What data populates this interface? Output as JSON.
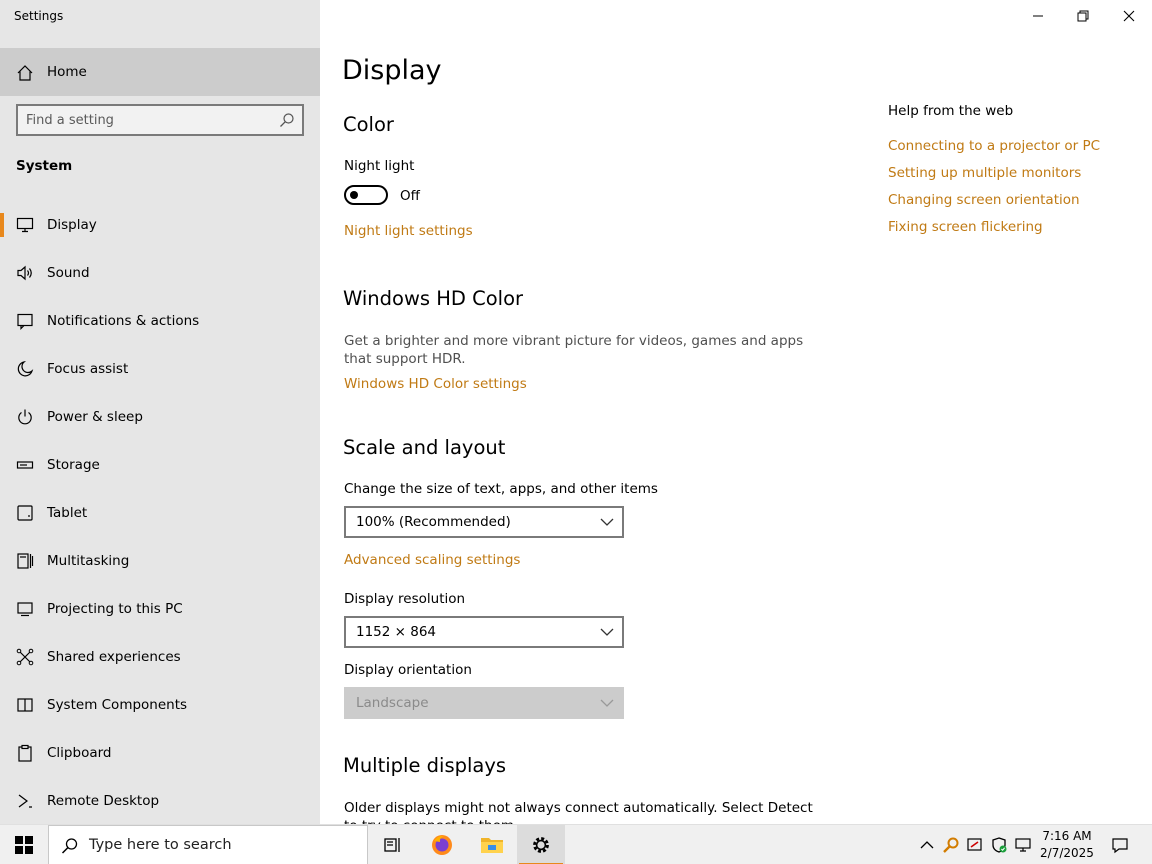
{
  "window": {
    "title": "Settings"
  },
  "sidebar": {
    "home_label": "Home",
    "search_placeholder": "Find a setting",
    "section_label": "System",
    "items": [
      {
        "label": "Display",
        "icon": "monitor-icon",
        "active": true
      },
      {
        "label": "Sound",
        "icon": "speaker-icon"
      },
      {
        "label": "Notifications & actions",
        "icon": "notification-icon"
      },
      {
        "label": "Focus assist",
        "icon": "moon-icon"
      },
      {
        "label": "Power & sleep",
        "icon": "power-icon"
      },
      {
        "label": "Storage",
        "icon": "storage-icon"
      },
      {
        "label": "Tablet",
        "icon": "tablet-icon"
      },
      {
        "label": "Multitasking",
        "icon": "multitasking-icon"
      },
      {
        "label": "Projecting to this PC",
        "icon": "projecting-icon"
      },
      {
        "label": "Shared experiences",
        "icon": "shared-icon"
      },
      {
        "label": "System Components",
        "icon": "components-icon"
      },
      {
        "label": "Clipboard",
        "icon": "clipboard-icon"
      },
      {
        "label": "Remote Desktop",
        "icon": "remote-desktop-icon"
      }
    ]
  },
  "main": {
    "title": "Display",
    "color": {
      "heading": "Color",
      "night_light_label": "Night light",
      "night_light_state": "Off",
      "night_light_settings_link": "Night light settings"
    },
    "hdr": {
      "heading": "Windows HD Color",
      "description": "Get a brighter and more vibrant picture for videos, games and apps that support HDR.",
      "settings_link": "Windows HD Color settings"
    },
    "scale": {
      "heading": "Scale and layout",
      "size_label": "Change the size of text, apps, and other items",
      "size_value": "100% (Recommended)",
      "advanced_link": "Advanced scaling settings",
      "resolution_label": "Display resolution",
      "resolution_value": "1152 × 864",
      "orientation_label": "Display orientation",
      "orientation_value": "Landscape"
    },
    "multiple": {
      "heading": "Multiple displays",
      "description": "Older displays might not always connect automatically. Select Detect to try to connect to them."
    }
  },
  "help": {
    "title": "Help from the web",
    "links": [
      "Connecting to a projector or PC",
      "Setting up multiple monitors",
      "Changing screen orientation",
      "Fixing screen flickering"
    ]
  },
  "taskbar": {
    "search_placeholder": "Type here to search",
    "time": "7:16 AM",
    "date": "2/7/2025"
  },
  "colors": {
    "accent": "#e8881c",
    "link": "#c07a14",
    "sidebar_bg": "#e6e6e6"
  }
}
